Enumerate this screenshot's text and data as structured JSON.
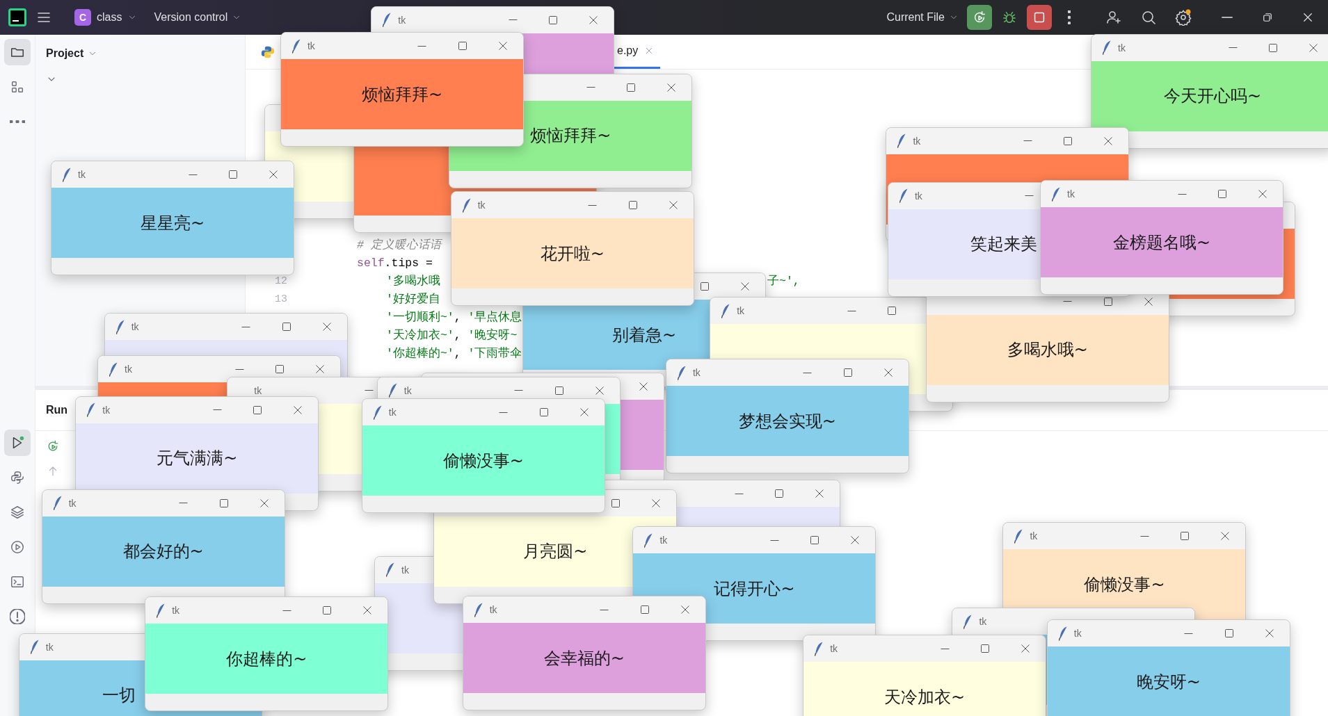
{
  "ide": {
    "project": {
      "initial": "C",
      "name": "class"
    },
    "vcs": "Version control",
    "run_config": "Current File",
    "tool_strip": [
      {
        "kind": "folder",
        "selected": true
      },
      {
        "kind": "structure",
        "selected": false
      },
      {
        "kind": "more",
        "selected": false
      }
    ],
    "bottom_strip": [
      {
        "kind": "run",
        "selected": true
      },
      {
        "kind": "python",
        "selected": false
      },
      {
        "kind": "layers",
        "selected": false
      },
      {
        "kind": "services",
        "selected": false
      },
      {
        "kind": "terminal",
        "selected": false
      },
      {
        "kind": "problems",
        "selected": false
      }
    ],
    "project_panel": {
      "title": "Project"
    },
    "editor_tab": {
      "label": "e.py",
      "selected": true
    },
    "code_lines": [
      {
        "kind": "statement",
        "segments": [
          {
            "kind": "comment",
            "text": "# 定义暖心话语"
          }
        ]
      },
      {
        "kind": "statement",
        "segments": [
          {
            "kind": "self",
            "text": "self"
          },
          {
            "kind": "plain",
            "text": ".tips ="
          }
        ]
      },
      {
        "kind": "continuation",
        "number": "12",
        "segments": [
          {
            "kind": "string",
            "text": "'多喝水哦"
          }
        ],
        "right": "子~',"
      },
      {
        "kind": "continuation",
        "number": "13",
        "segments": [
          {
            "kind": "string",
            "text": "'好好爱自"
          }
        ]
      },
      {
        "kind": "continuation",
        "segments": [
          {
            "kind": "string",
            "text": "'一切顺利~'"
          },
          {
            "kind": "plain",
            "text": ", "
          },
          {
            "kind": "string",
            "text": "'早点休息"
          }
        ]
      },
      {
        "kind": "continuation",
        "segments": [
          {
            "kind": "string",
            "text": "'天冷加衣~'"
          },
          {
            "kind": "plain",
            "text": ", "
          },
          {
            "kind": "string",
            "text": "'晚安呀~"
          }
        ]
      },
      {
        "kind": "continuation",
        "segments": [
          {
            "kind": "string",
            "text": "'你超棒的~'"
          },
          {
            "kind": "plain",
            "text": ", "
          },
          {
            "kind": "string",
            "text": "'下雨带伞"
          }
        ]
      }
    ],
    "run_panel": {
      "title": "Run"
    }
  },
  "windows": [
    {
      "title": "tk",
      "color": "#dda0dd"
    },
    {
      "color": "#ffffe0"
    },
    {
      "color": "#ff7f50"
    },
    {
      "message": "烦恼拜拜~",
      "color": "#90ee90"
    },
    {
      "title": "tk",
      "message": "烦恼拜拜~",
      "color": "#ff7f50"
    },
    {
      "title": "tk",
      "message": "星星亮~",
      "color": "#87ceeb"
    },
    {
      "message": "别着急~",
      "color": "#87ceeb"
    },
    {
      "title": "tk",
      "message": "花开啦~",
      "color": "#ffe4c4"
    },
    {
      "title": "tk",
      "color": "#ffffe0"
    },
    {
      "title": "tk",
      "message": "今天开心吗~",
      "color": "#90ee90"
    },
    {
      "title": "tk",
      "color": "#ff7f50"
    },
    {
      "color": "#ff7f50"
    },
    {
      "message": "多喝水哦~",
      "color": "#ffe4c4"
    },
    {
      "title": "tk",
      "message": "笑起来美",
      "color": "#e6e6fa"
    },
    {
      "title": "tk",
      "message": "金榜题名哦~",
      "color": "#dda0dd"
    },
    {
      "title": "tk",
      "message": "梦想会实现~",
      "color": "#87ceeb"
    },
    {
      "title": "tk",
      "color": "#e6e6fa"
    },
    {
      "title": "tk",
      "color": "#ff7f50"
    },
    {
      "title": "tk",
      "color": "#ffffe0"
    },
    {
      "color": "#dda0dd"
    },
    {
      "title": "tk",
      "color": "#7fffd4"
    },
    {
      "color": "#e6e6fa"
    },
    {
      "title": "tk",
      "color": "#e6e6fa"
    },
    {
      "message": "月亮圆~",
      "color": "#ffffe0"
    },
    {
      "title": "tk",
      "message": "元气满满~",
      "color": "#e6e6fa"
    },
    {
      "title": "tk",
      "message": "偷懒没事~",
      "color": "#7fffd4"
    },
    {
      "title": "tk",
      "message": "都会好的~",
      "color": "#87ceeb"
    },
    {
      "title": "tk",
      "message": "记得开心~",
      "color": "#87ceeb"
    },
    {
      "title": "tk",
      "message": "偷懒没事~",
      "color": "#ffe4c4"
    },
    {
      "title": "tk",
      "color": "#87ceeb"
    },
    {
      "title": "tk",
      "message": "会幸福的~",
      "color": "#dda0dd"
    },
    {
      "title": "tk",
      "message": "一切",
      "color": "#87ceeb"
    },
    {
      "title": "tk",
      "message": "你超棒的~",
      "color": "#7fffd4"
    },
    {
      "title": "tk",
      "message": "天冷加衣~",
      "color": "#ffffe0"
    },
    {
      "title": "tk",
      "message": "晚安呀~",
      "color": "#87ceeb"
    }
  ]
}
